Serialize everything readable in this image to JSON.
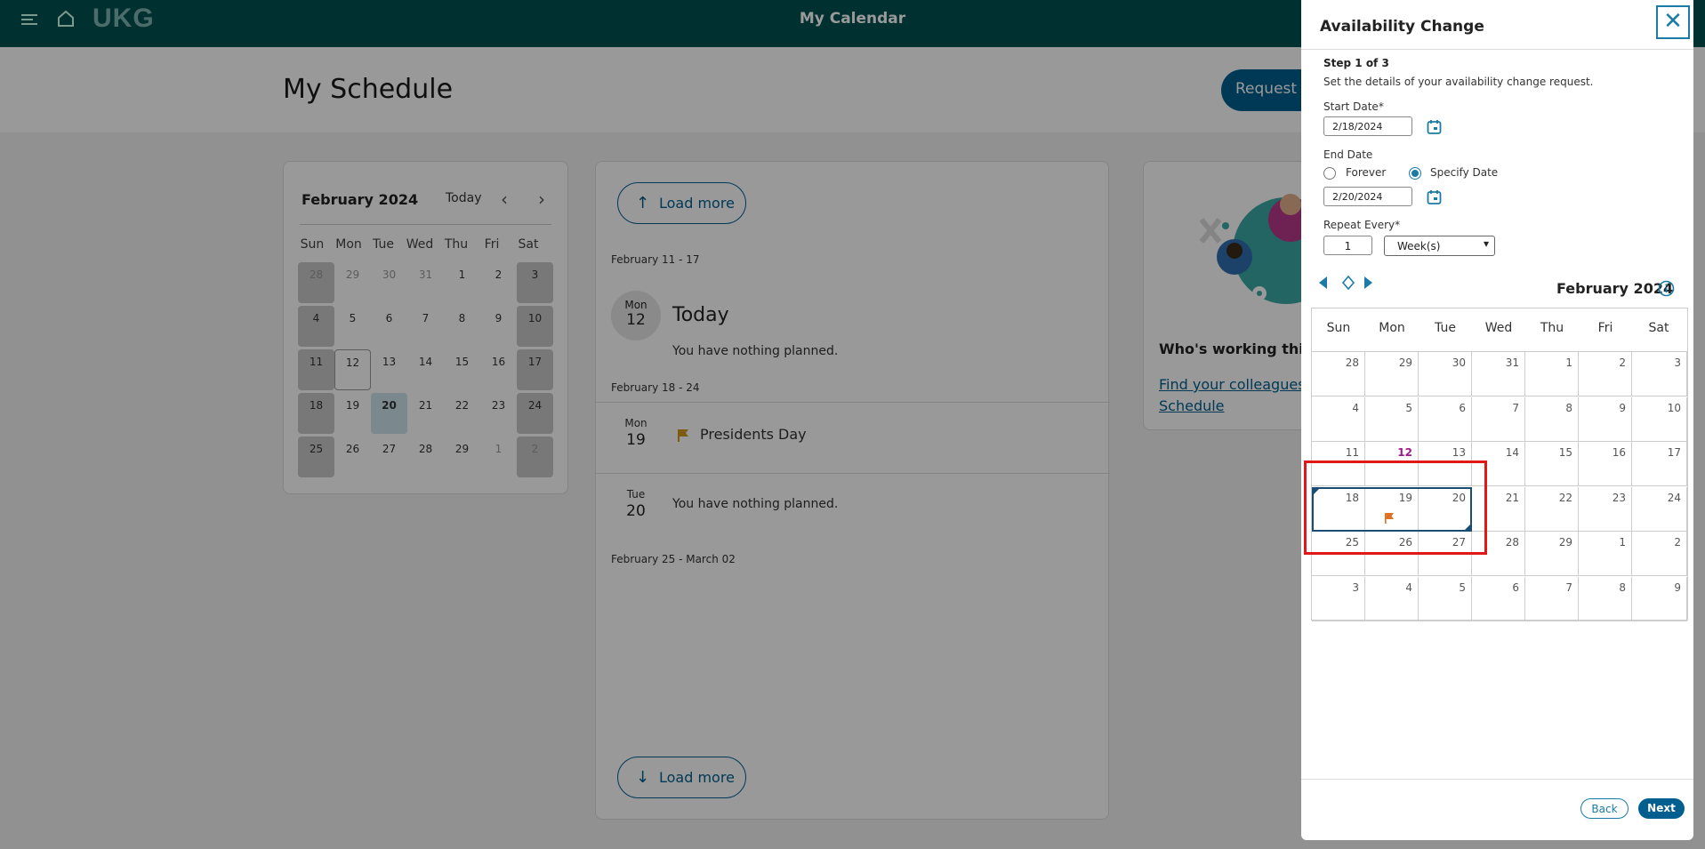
{
  "topbar": {
    "logo": "UKG",
    "title": "My Calendar"
  },
  "header": {
    "title": "My Schedule",
    "request_label": "Request"
  },
  "mini_calendar": {
    "month": "February 2024",
    "today_label": "Today",
    "dow": [
      "Sun",
      "Mon",
      "Tue",
      "Wed",
      "Thu",
      "Fri",
      "Sat"
    ],
    "weeks": [
      [
        "28",
        "29",
        "30",
        "31",
        "1",
        "2",
        "3"
      ],
      [
        "4",
        "5",
        "6",
        "7",
        "8",
        "9",
        "10"
      ],
      [
        "11",
        "12",
        "13",
        "14",
        "15",
        "16",
        "17"
      ],
      [
        "18",
        "19",
        "20",
        "21",
        "22",
        "23",
        "24"
      ],
      [
        "25",
        "26",
        "27",
        "28",
        "29",
        "1",
        "2"
      ]
    ]
  },
  "schedule": {
    "load_more": "Load more",
    "week1": "February 11 - 17",
    "today": {
      "dow": "Mon",
      "day": "12",
      "label": "Today",
      "note": "You have nothing planned."
    },
    "week2": "February 18 - 24",
    "d19": {
      "dow": "Mon",
      "day": "19",
      "holiday": "Presidents Day"
    },
    "d20": {
      "dow": "Tue",
      "day": "20",
      "note": "You have nothing planned."
    },
    "week3": "February 25 - March 02"
  },
  "who": {
    "heading": "Who's working this",
    "link": "Find your colleagues Schedule"
  },
  "panel": {
    "title": "Availability Change",
    "step": "Step 1 of 3",
    "step_desc": "Set the details of your availability change request.",
    "start_label": "Start Date",
    "start_value": "2/18/2024",
    "end_label": "End Date",
    "forever": "Forever",
    "specify": "Specify Date",
    "end_value": "2/20/2024",
    "repeat_label": "Repeat Every",
    "repeat_value": "1",
    "repeat_unit": "Week(s)",
    "month": "February 2024",
    "dow": [
      "Sun",
      "Mon",
      "Tue",
      "Wed",
      "Thu",
      "Fri",
      "Sat"
    ],
    "weeks": [
      [
        "28",
        "29",
        "30",
        "31",
        "1",
        "2",
        "3"
      ],
      [
        "4",
        "5",
        "6",
        "7",
        "8",
        "9",
        "10"
      ],
      [
        "11",
        "12",
        "13",
        "14",
        "15",
        "16",
        "17"
      ],
      [
        "18",
        "19",
        "20",
        "21",
        "22",
        "23",
        "24"
      ],
      [
        "25",
        "26",
        "27",
        "28",
        "29",
        "1",
        "2"
      ],
      [
        "3",
        "4",
        "5",
        "6",
        "7",
        "8",
        "9"
      ]
    ],
    "back": "Back",
    "next": "Next"
  },
  "colors": {
    "topbar": "#005151",
    "primary": "#005f8f",
    "today_purple": "#a0168c",
    "highlight": "#e01818"
  }
}
